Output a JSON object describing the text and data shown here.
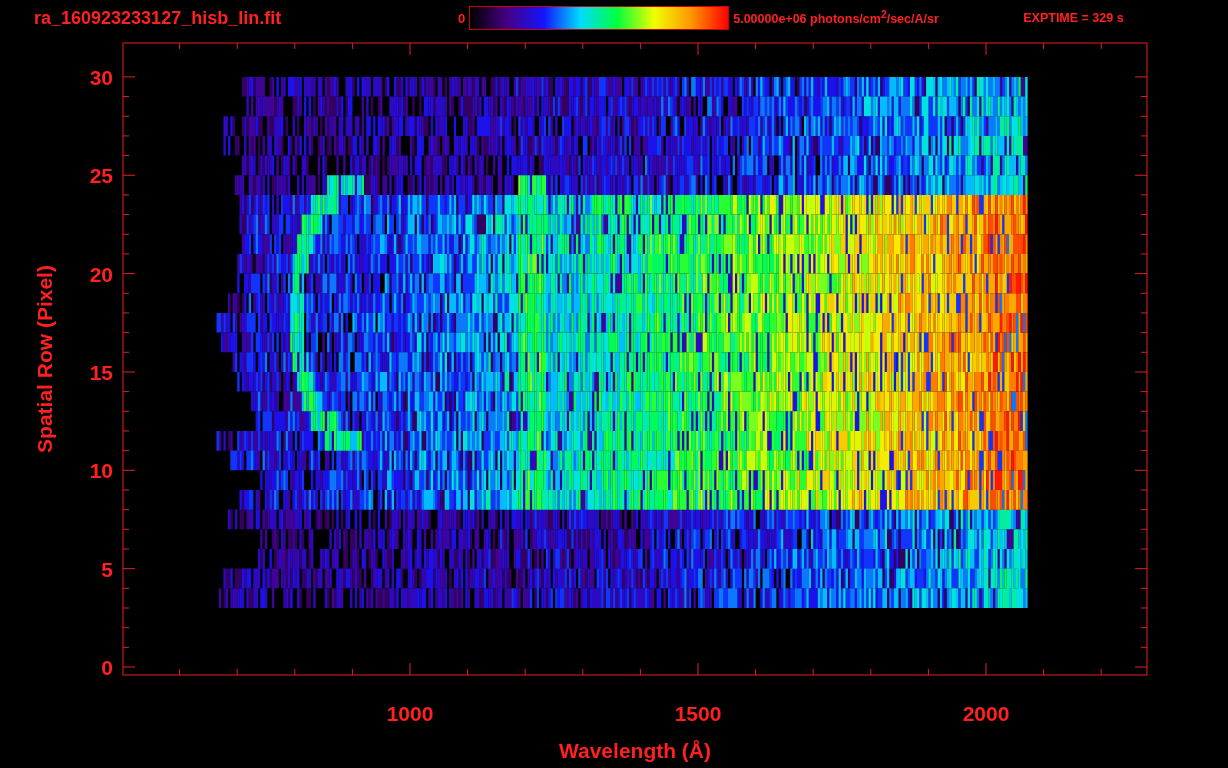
{
  "title": "ra_160923233127_hisb_lin.fit",
  "colorbar": {
    "min_label": "0",
    "max_label": "5.00000e+06 photons/cm$^{2}$/sec/A/sr"
  },
  "exposure": "EXPTIME = 329 s",
  "y_axis": {
    "title": "Spatial Row (Pixel)",
    "ticks": [
      "30",
      "25",
      "20",
      "15",
      "10",
      "5",
      "0"
    ]
  },
  "x_axis": {
    "title": "Wavelength (Å)",
    "ticks": [
      "1000",
      "1500",
      "2000"
    ]
  }
}
